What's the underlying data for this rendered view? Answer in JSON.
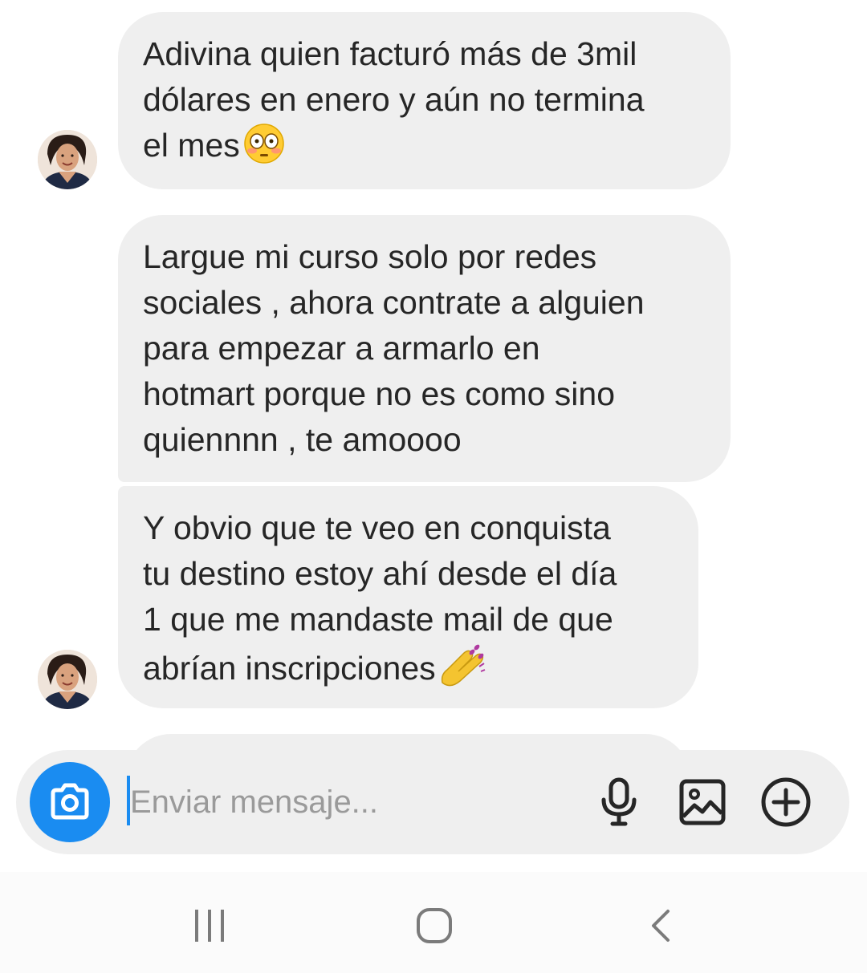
{
  "messages": [
    {
      "text": "Adivina quien facturó más de 3mil\ndólares en enero y aún no termina\nel mes",
      "emoji": "flushed-face-emoji"
    },
    {
      "text": "Largue mi curso solo por redes\nsociales , ahora contrate a alguien\npara empezar a armarlo en\nhotmart porque no es como sino\nquiennnn , te amoooo"
    },
    {
      "text": "Y obvio que te veo en conquista\ntu destino estoy ahí desde el día\n1 que me mandaste mail de que\nabrían inscripciones",
      "emoji": "nail-polish-emoji"
    }
  ],
  "composer": {
    "placeholder": "Enviar mensaje...",
    "icons": [
      "camera-icon",
      "microphone-icon",
      "gallery-icon",
      "plus-icon"
    ]
  },
  "nav_bar": {
    "icons": [
      "recents-icon",
      "home-icon",
      "back-icon"
    ]
  },
  "colors": {
    "bubble": "#efefef",
    "text": "#262626",
    "accent": "#1a8cf1",
    "placeholder": "#9a9a9a"
  }
}
